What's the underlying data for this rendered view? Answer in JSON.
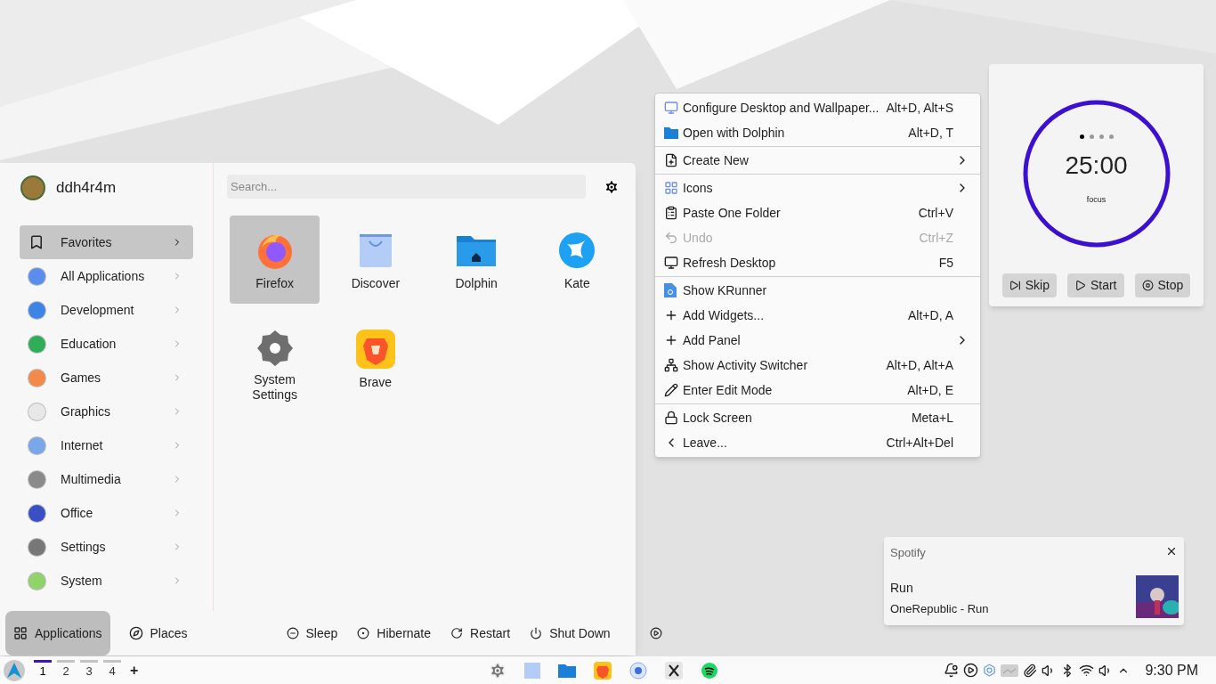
{
  "launcher": {
    "user": {
      "name": "ddh4r4m"
    },
    "categories": [
      {
        "label": "Favorites",
        "kind": "bookmark",
        "selected": true
      },
      {
        "label": "All Applications",
        "kind": "category",
        "color": "#5b8def",
        "selected": false
      },
      {
        "label": "Development",
        "kind": "category",
        "color": "#3d84e6",
        "selected": false
      },
      {
        "label": "Education",
        "kind": "category",
        "color": "#2fae5a",
        "selected": false
      },
      {
        "label": "Games",
        "kind": "category",
        "color": "#f48a4a",
        "selected": false
      },
      {
        "label": "Graphics",
        "kind": "category",
        "color": "#e8e8e8",
        "selected": false
      },
      {
        "label": "Internet",
        "kind": "category",
        "color": "#7aa6ea",
        "selected": false
      },
      {
        "label": "Multimedia",
        "kind": "category",
        "color": "#8a8a8a",
        "selected": false
      },
      {
        "label": "Office",
        "kind": "category",
        "color": "#3b4fc4",
        "selected": false
      },
      {
        "label": "Settings",
        "kind": "category",
        "color": "#777777",
        "selected": false
      },
      {
        "label": "System",
        "kind": "category",
        "color": "#8fd36a",
        "selected": false
      }
    ],
    "search": {
      "placeholder": "Search..."
    },
    "apps": [
      {
        "label": "Firefox",
        "selected": true
      },
      {
        "label": "Discover",
        "selected": false
      },
      {
        "label": "Dolphin",
        "selected": false
      },
      {
        "label": "Kate",
        "selected": false
      },
      {
        "label": "System Settings",
        "selected": false
      },
      {
        "label": "Brave",
        "selected": false
      }
    ],
    "views": [
      {
        "label": "Applications",
        "selected": true
      },
      {
        "label": "Places",
        "selected": false
      }
    ],
    "power": [
      "Sleep",
      "Hibernate",
      "Restart",
      "Shut Down"
    ]
  },
  "context_menu": {
    "sections": [
      [
        {
          "label": "Configure Desktop and Wallpaper...",
          "shortcut": "Alt+D, Alt+S",
          "disabled": false,
          "submenu": false
        },
        {
          "label": "Open with Dolphin",
          "shortcut": "Alt+D, T",
          "disabled": false,
          "submenu": false
        }
      ],
      [
        {
          "label": "Create New",
          "disabled": false,
          "submenu": true
        }
      ],
      [
        {
          "label": "Icons",
          "disabled": false,
          "submenu": true
        },
        {
          "label": "Paste One Folder",
          "shortcut": "Ctrl+V",
          "disabled": false,
          "submenu": false
        },
        {
          "label": "Undo",
          "shortcut": "Ctrl+Z",
          "disabled": true,
          "submenu": false
        },
        {
          "label": "Refresh Desktop",
          "shortcut": "F5",
          "disabled": false,
          "submenu": false
        }
      ],
      [
        {
          "label": "Show KRunner",
          "disabled": false,
          "submenu": false
        },
        {
          "label": "Add Widgets...",
          "shortcut": "Alt+D, A",
          "disabled": false,
          "submenu": false
        },
        {
          "label": "Add Panel",
          "disabled": false,
          "submenu": true
        },
        {
          "label": "Show Activity Switcher",
          "shortcut": "Alt+D, Alt+A",
          "disabled": false,
          "submenu": false
        },
        {
          "label": "Enter Edit Mode",
          "shortcut": "Alt+D, E",
          "disabled": false,
          "submenu": false
        }
      ],
      [
        {
          "label": "Lock Screen",
          "shortcut": "Meta+L",
          "disabled": false,
          "submenu": false
        },
        {
          "label": "Leave...",
          "shortcut": "Ctrl+Alt+Del",
          "disabled": false,
          "submenu": false
        }
      ]
    ]
  },
  "pomodoro": {
    "time": "25:00",
    "phase": "focus",
    "sessions": [
      {
        "active": true
      },
      {
        "active": false
      },
      {
        "active": false
      },
      {
        "active": false
      }
    ],
    "buttons": [
      "Skip",
      "Start",
      "Stop"
    ]
  },
  "notification": {
    "app": "Spotify",
    "title": "Run",
    "body": "OneRepublic - Run"
  },
  "taskbar": {
    "desktops": [
      {
        "label": "1",
        "selected": true
      },
      {
        "label": "2",
        "selected": false
      },
      {
        "label": "3",
        "selected": false
      },
      {
        "label": "4",
        "selected": false
      }
    ],
    "add": "+",
    "clock": "9:30 PM"
  }
}
